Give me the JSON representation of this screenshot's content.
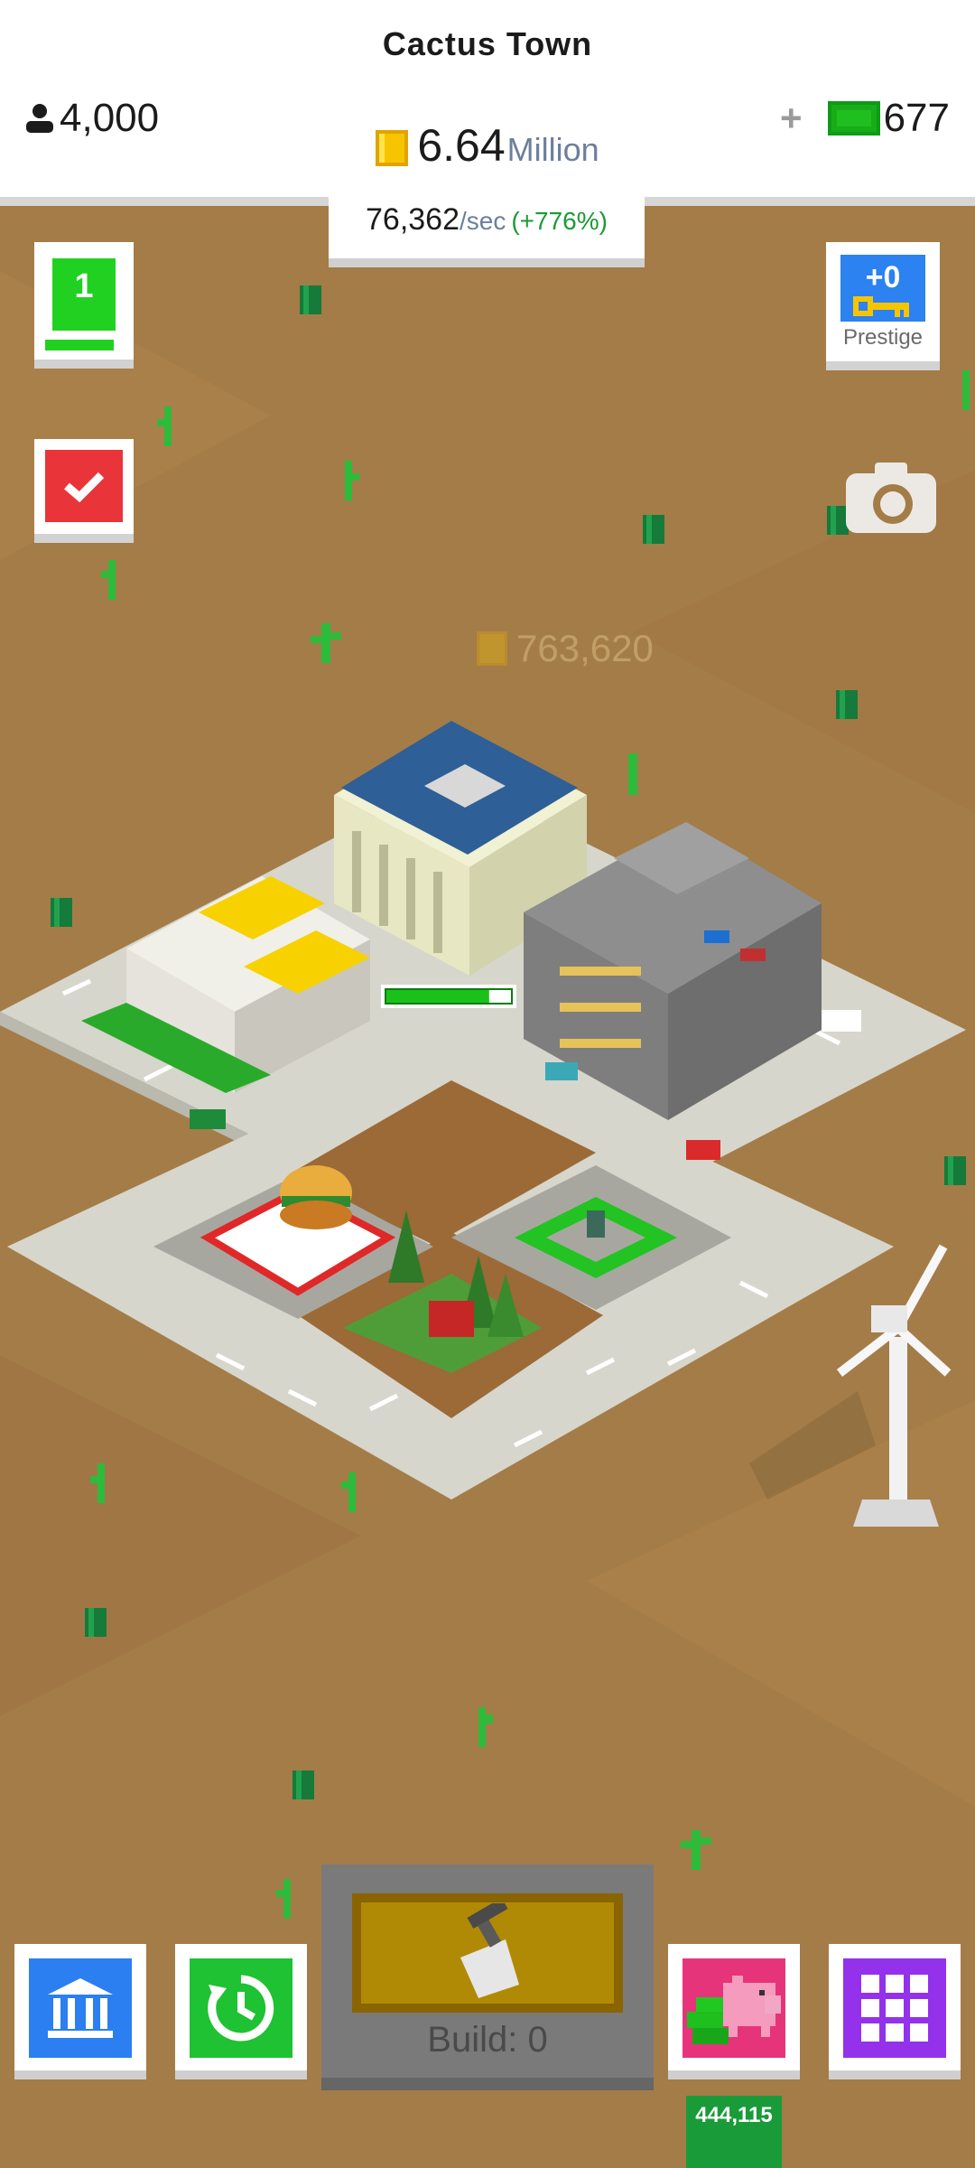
{
  "header": {
    "town_name": "Cactus Town",
    "population": "4,000",
    "money_value": "6.64",
    "money_unit": "Million",
    "cash_plus": "+",
    "cash_value": "677",
    "rate_value": "76,362",
    "rate_unit": "/sec",
    "rate_bonus": "(+776%)"
  },
  "side": {
    "level": "1",
    "prestige_count": "+0",
    "prestige_label": "Prestige"
  },
  "world": {
    "floating_income": "763,620",
    "progress_fraction": 0.82
  },
  "bottom": {
    "build_label": "Build: 0",
    "piggy_amount": "444,115"
  },
  "icons": [
    "person-icon",
    "coin-icon",
    "cash-icon",
    "key-icon",
    "checkmark-icon",
    "camera-icon",
    "bank-icon",
    "clock-icon",
    "hammer-icon",
    "piggy-bank-icon",
    "grid-icon",
    "windmill-icon"
  ],
  "colors": {
    "ground": "#a47c48",
    "road": "#d6d6cc",
    "accent_green": "#21d121",
    "accent_blue": "#2b82f0",
    "accent_red": "#e9353a",
    "accent_purple": "#9332ea"
  }
}
